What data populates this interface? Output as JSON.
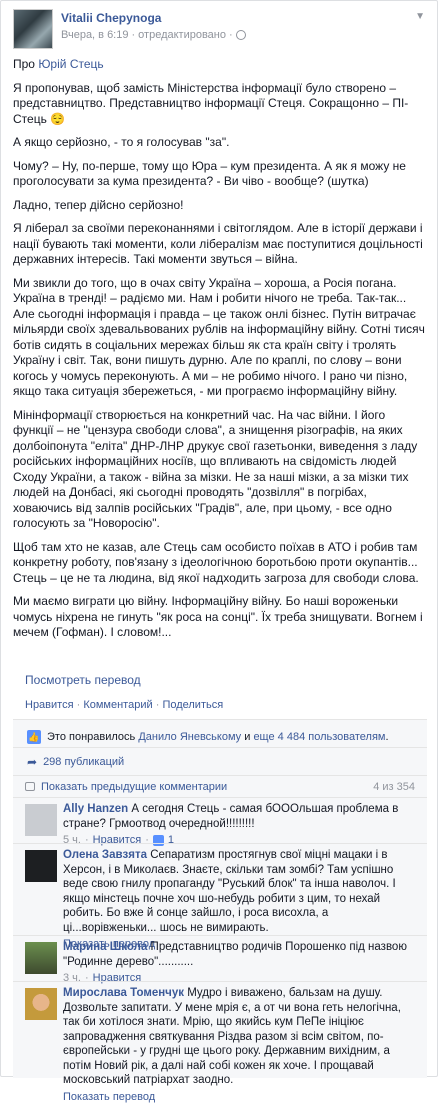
{
  "post": {
    "author": "Vitalii Chepynoga",
    "timestamp": "Вчера, в 6:19",
    "sep": "·",
    "edited": "отредактировано",
    "about_prefix": "Про ",
    "about_link": "Юрій Стець",
    "paragraphs": [
      "Я пропонував, щоб замість Міністерства інформації було створено – представництво. Представництво інформації Стеця. Сокращонно – ПІ-Стець 😌",
      "А якщо серйозно, - то я голосував \"за\".",
      "Чому? – Ну, по-перше, тому що Юра – кум президента. А як я можу не проголосувати за кума президента? - Ви чіво - вообще? (шутка)",
      "Ладно, тепер дійсно серйозно!",
      "Я ліберал за своїми переконаннями і світоглядом. Але в історії держави і нації бувають такі моменти, коли лібералізм має поступитися доцільності державних інтересів. Такі моменти звуться – війна.",
      "Ми звикли до того, що в очах світу Україна – хороша, а Росія погана. Україна в тренді! – радіємо ми. Нам і робити нічого не треба. Так-так... Але сьогодні інформація і правда – це також онлі бізнес. Путін витрачає мільярди своїх здевальвованих рублів на інформаційну війну. Сотні тисяч ботів сидять в соціальних мережах більш як ста країн світу і тролять Україну і світ. Так, вони пишуть дурню. Але по краплі, по слову – вони когось у чомусь переконують. А ми – не робимо нічого. І рано чи пізно, якщо така ситуація збережеться, - ми програємо інформаційну війну.",
      "Мінінформації створюється на конкретний час. На час війни. І його функції – не \"цензура свободи слова\", а знищення різографів, на яких долбоіпонута \"еліта\" ДНР-ЛНР друкує свої газетьонки, виведення з ладу російських інформаційних носіїв, що впливають на свідомість людей Сходу України, а також - війна за мізки. Не за наші мізки, а за мізки тих людей на Донбасі, які сьогодні проводять \"дозвілля\" в погрібах, ховаючись від залпів російських \"Градів\", але, при цьому, - все одно голосують за \"Новоросію\".",
      "Щоб там хто не казав, але Стець сам особисто поїхав в АТО і робив там конкретну роботу, пов'язану з ідеологічною боротьбою проти окупантів... Стець – це не та людина, від якої надходить загроза для свободи слова.",
      "Ми маємо виграти цю війну. Інформаційну війну. Бо наші вороженьки чомусь ніхрена не гинуть \"як роса на сонці\". Їх треба знищувати. Вогнем і мечем (Гофман). І словом!..."
    ],
    "see_translation": "Посмотреть перевод",
    "actions": {
      "like": "Нравится",
      "comment": "Комментарий",
      "share": "Поделиться",
      "dot": "·"
    }
  },
  "likes": {
    "prefix": "Это понравилось ",
    "user": "Данило Яневському",
    "mid": " и ",
    "others": "еще 4 484 пользователям",
    "suffix": "."
  },
  "shares": {
    "label": "298 публикаций"
  },
  "comments_header": {
    "label": "Показать предыдущие комментарии",
    "count": "4 из 354"
  },
  "comments": [
    {
      "name": "Ally Hanzen",
      "text": " А сегодня Стець - самая бОООльшая проблема в стране? Грмоотвод очередной!!!!!!!!!",
      "time": "5 ч.",
      "like": "Нравится",
      "likes": "1",
      "translate": ""
    },
    {
      "name": "Олена Завзята",
      "text": " Сепаратизм простягнув свої міцні мацаки і в Херсон, і в Миколаєв. Знаєте, скільки там зомбі? Там успішно веде свою гнилу пропаганду \"Руський блок\" та інша наволоч. І якщо мінстець почне хоч шо-небудь робити з цим, то нехай робить. Бо вже й сонце зайшло, і роса висохла, а ці...ворівженьки... шось не вимирають.",
      "time": "",
      "like": "",
      "likes": "",
      "translate": "Показать перевод"
    },
    {
      "name": "Марина Школа",
      "text": " Представництво родичів Порошенко під назвою \"Родинне дерево\"...........",
      "time": "3 ч.",
      "like": "Нравится",
      "likes": "",
      "translate": ""
    },
    {
      "name": "Мирослава Томенчук",
      "text": " Мудро і виважено, бальзам на душу. Дозвольте запитати. У мене мрія є, а от чи вона геть нелогічна, так би хотілося знати. Мрію, що якийсь кум ПеПе ініціює запровадження святкування Різдва разом зі всім світом, по-європейськи - у грудні ще цього року. Державним вихідним, а потім Новий рік, а далі най собі кожен як хоче. І прощавай московський патріархат заодно.",
      "time": "",
      "like": "",
      "likes": "",
      "translate": "Показать перевод"
    }
  ]
}
